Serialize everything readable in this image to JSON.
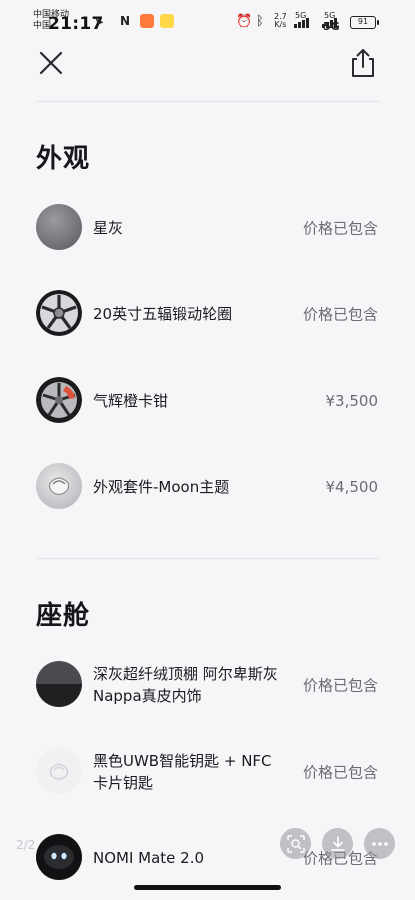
{
  "status_bar": {
    "carrier_line1": "中国移动",
    "carrier_line2": "中国",
    "time": "21:17",
    "net_speed_value": "2.7",
    "net_speed_unit": "K/s",
    "sim1_label": "5G",
    "sim2_label": "5G",
    "network_label": "5G",
    "battery_level": "91"
  },
  "toolbar": {
    "close_icon": "close-icon",
    "share_icon": "share-icon"
  },
  "sections": {
    "exterior": {
      "title": "外观",
      "items": [
        {
          "name": "星灰",
          "price": "价格已包含",
          "icon": "grey-paint-swatch"
        },
        {
          "name": "20英寸五辐锻动轮圈",
          "price": "价格已包含",
          "icon": "wheel-rim"
        },
        {
          "name": "气辉橙卡钳",
          "price": "¥3,500",
          "icon": "orange-caliper"
        },
        {
          "name": "外观套件-Moon主题",
          "price": "¥4,500",
          "icon": "moon-theme-kit"
        }
      ]
    },
    "cabin": {
      "title": "座舱",
      "items": [
        {
          "name": "深灰超纤绒顶棚 阿尔卑斯灰Nappa真皮内饰",
          "price": "价格已包含",
          "icon": "interior-trim"
        },
        {
          "name": "黑色UWB智能钥匙 + NFC卡片钥匙",
          "price": "价格已包含",
          "icon": "smart-key"
        },
        {
          "name": "NOMI Mate 2.0",
          "price": "价格已包含",
          "icon": "nomi-robot"
        }
      ]
    }
  },
  "overlay": {
    "page_indicator": "2/2"
  },
  "colors": {
    "background": "#f6f6f8",
    "text_primary": "#1e1f22",
    "text_secondary": "#6b6d73",
    "divider": "#e4e4e8"
  }
}
